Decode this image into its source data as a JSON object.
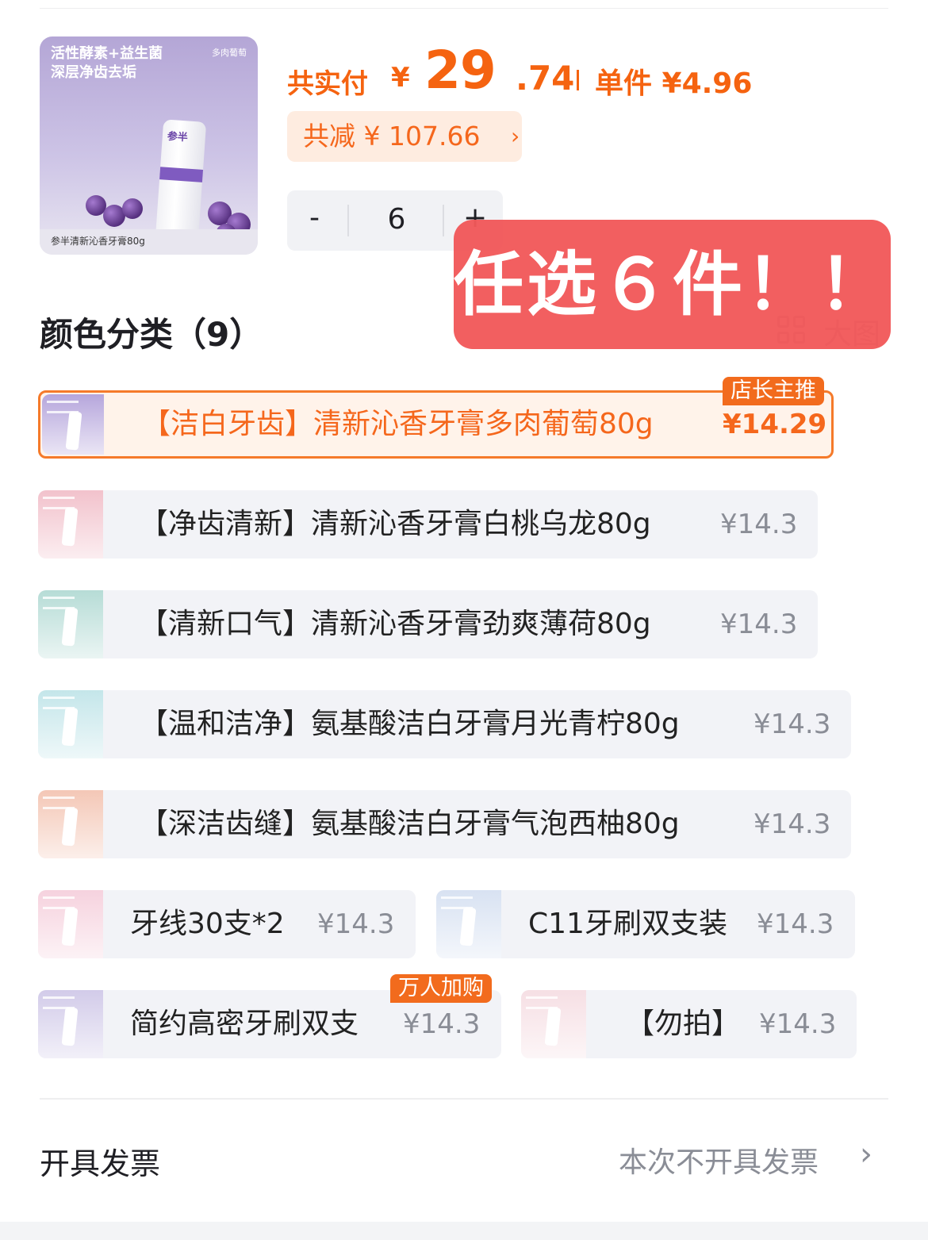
{
  "product": {
    "thumb_headline_1": "活性酵素+益生菌",
    "thumb_headline_2": "深层净齿去垢",
    "thumb_brand": "多肉葡萄",
    "tube_logo": "参半",
    "thumb_caption": "参半清新沁香牙膏80g"
  },
  "price": {
    "total_label": "共实付",
    "currency": "¥",
    "total_integer": "29",
    "total_decimal": ".74",
    "unit_label": "单件 ¥4.96",
    "discount_label": "共减 ¥ 107.66",
    "discount_chevron": "›"
  },
  "stepper": {
    "minus": "-",
    "quantity": "6",
    "plus": "+"
  },
  "overlay": {
    "text": "任选６件！！"
  },
  "section": {
    "title": "颜色分类（9）",
    "big_view": "大图"
  },
  "options": [
    {
      "name": "【洁白牙齿】清新沁香牙膏多肉葡萄80g",
      "price": "¥14.29",
      "badge": "店长主推",
      "selected": true,
      "color": "#b6a6dc"
    },
    {
      "name": "【净齿清新】清新沁香牙膏白桃乌龙80g",
      "price": "¥14.3",
      "color": "#f2c2cc"
    },
    {
      "name": "【清新口气】清新沁香牙膏劲爽薄荷80g",
      "price": "¥14.3",
      "color": "#b6dcd6"
    },
    {
      "name": "【温和洁净】氨基酸洁白牙膏月光青柠80g",
      "price": "¥14.3",
      "color": "#c4e6ea"
    },
    {
      "name": "【深洁齿缝】氨基酸洁白牙膏气泡西柚80g",
      "price": "¥14.3",
      "color": "#f4c7b6"
    },
    {
      "name": "牙线30支*2",
      "price": "¥14.3",
      "color": "#f6d2de"
    },
    {
      "name": "C11牙刷双支装",
      "price": "¥14.3",
      "color": "#d8e2f2"
    },
    {
      "name": "简约高密牙刷双支",
      "price": "¥14.3",
      "badge": "万人加购",
      "color": "#d2cbe9"
    },
    {
      "name": "【勿拍】",
      "price": "¥14.3",
      "color": "#f6dfe4"
    }
  ],
  "invoice": {
    "label": "开具发票",
    "value": "本次不开具发票",
    "chevron": "›"
  },
  "colors": {
    "accent": "#f56310",
    "selected_border": "#f57a2a",
    "overlay": "#f2595a",
    "chip_bg": "#f2f3f7"
  }
}
